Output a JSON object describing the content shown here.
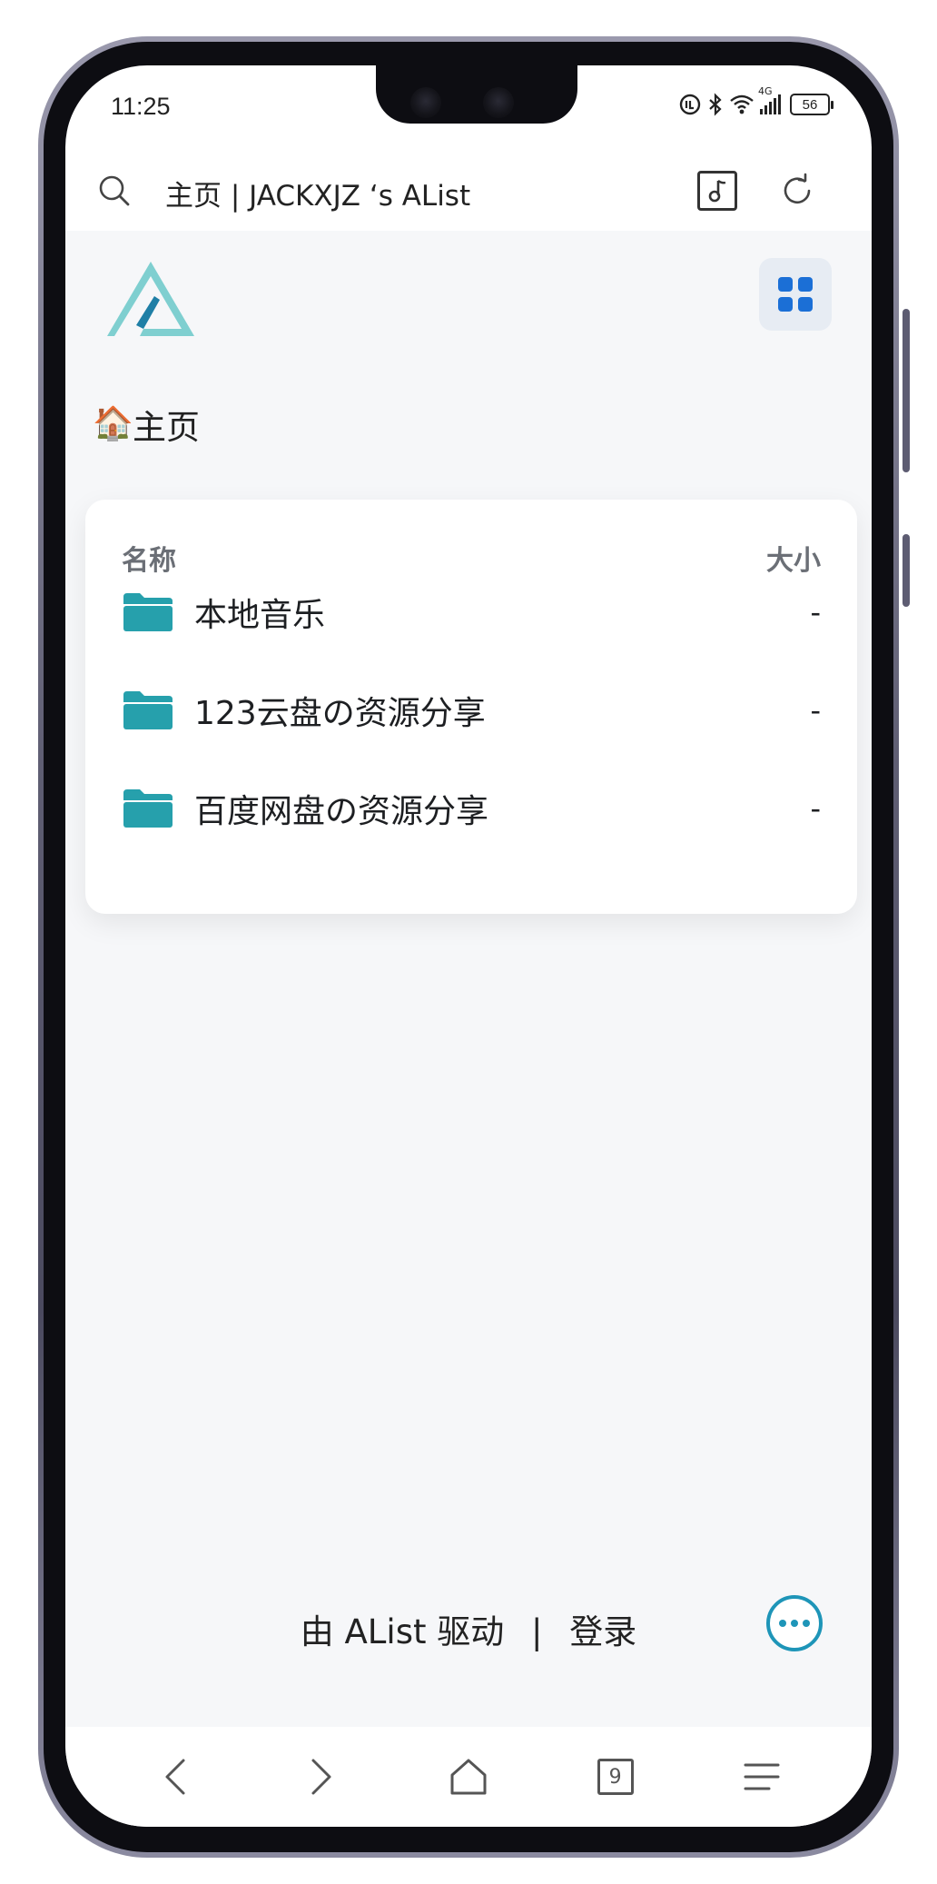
{
  "status_bar": {
    "time": "11:25",
    "network": "4G",
    "battery": "56"
  },
  "browser": {
    "title": "主页 | JACKXJZ ‘s AList",
    "tab_count": "9",
    "icons": {
      "search": "search-icon",
      "music": "music-note-icon",
      "refresh": "refresh-icon"
    }
  },
  "page": {
    "breadcrumb": {
      "emoji": "🏠",
      "label": "主页"
    },
    "table": {
      "columns": {
        "name": "名称",
        "size": "大小"
      },
      "rows": [
        {
          "name": "本地音乐",
          "size": "-"
        },
        {
          "name": "123云盘の资源分享",
          "size": "-"
        },
        {
          "name": "百度网盘の资源分享",
          "size": "-"
        }
      ]
    },
    "footer": {
      "powered_by": "由 AList 驱动",
      "separator": "|",
      "login": "登录"
    }
  },
  "colors": {
    "accent": "#1e95b8",
    "folder": "#26a0ac",
    "logo_light": "#7fcfd0",
    "logo_dark": "#1f7fa6",
    "grid_icon": "#1b6fd6",
    "page_bg": "#f6f7f9"
  }
}
